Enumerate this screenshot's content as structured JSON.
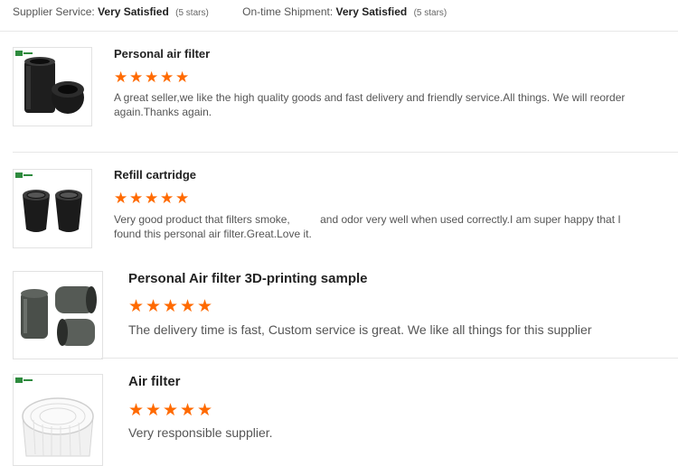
{
  "summary": {
    "supplier_service_label": "Supplier Service:",
    "supplier_service_value": "Very Satisfied",
    "supplier_service_stars": "(5 stars)",
    "shipment_label": "On-time Shipment:",
    "shipment_value": "Very Satisfied",
    "shipment_stars": "(5 stars)"
  },
  "colors": {
    "star": "#ff6a00",
    "logo_green": "#2e8b3e",
    "divider": "#e6e6e6"
  },
  "reviews": [
    {
      "title": "Personal air filter",
      "rating": 5,
      "text": "A great seller,we like the high quality goods and fast delivery and friendly service.All things. We will reorder again.Thanks again.",
      "image": "black-cylinder-air-filters"
    },
    {
      "title": "Refill cartridge",
      "rating": 5,
      "text": "Very good product that filters smoke,          and odor very well when used correctly.I am super happy that I found this personal air filter.Great.Love it.",
      "image": "black-refill-cartridges"
    },
    {
      "title": "Personal Air filter 3D-printing sample",
      "rating": 5,
      "text": "The delivery time is fast, Custom service is great. We like all things for this supplier",
      "image": "grey-3d-printed-filter-samples"
    },
    {
      "title": "Air filter",
      "rating": 5,
      "text": "Very responsible supplier.",
      "image": "white-round-air-filter"
    }
  ]
}
